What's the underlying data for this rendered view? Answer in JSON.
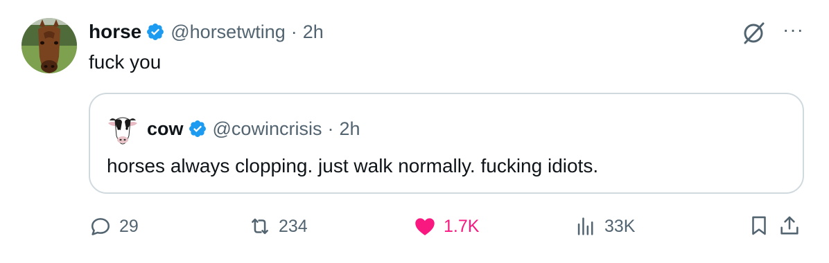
{
  "colors": {
    "text_primary": "#0f1419",
    "text_secondary": "#536471",
    "verified_blue": "#1d9bf0",
    "like_pink": "#f91880",
    "border": "#cfd9de"
  },
  "tweet": {
    "author": {
      "name": "horse",
      "handle": "@horsetwting",
      "time": "2h",
      "separator": "·",
      "avatar_icon": "horse-avatar"
    },
    "text": "fuck you",
    "top_icons": [
      "grok-icon",
      "more-icon"
    ],
    "more_label": "···"
  },
  "quote": {
    "author": {
      "name": "cow",
      "handle": "@cowincrisis",
      "time": "2h",
      "separator": "·",
      "avatar_icon": "cow-avatar"
    },
    "text": "horses always clopping. just walk normally. fucking idiots."
  },
  "actions": {
    "replies": "29",
    "reposts": "234",
    "likes": "1.7K",
    "views": "33K",
    "liked": true
  }
}
